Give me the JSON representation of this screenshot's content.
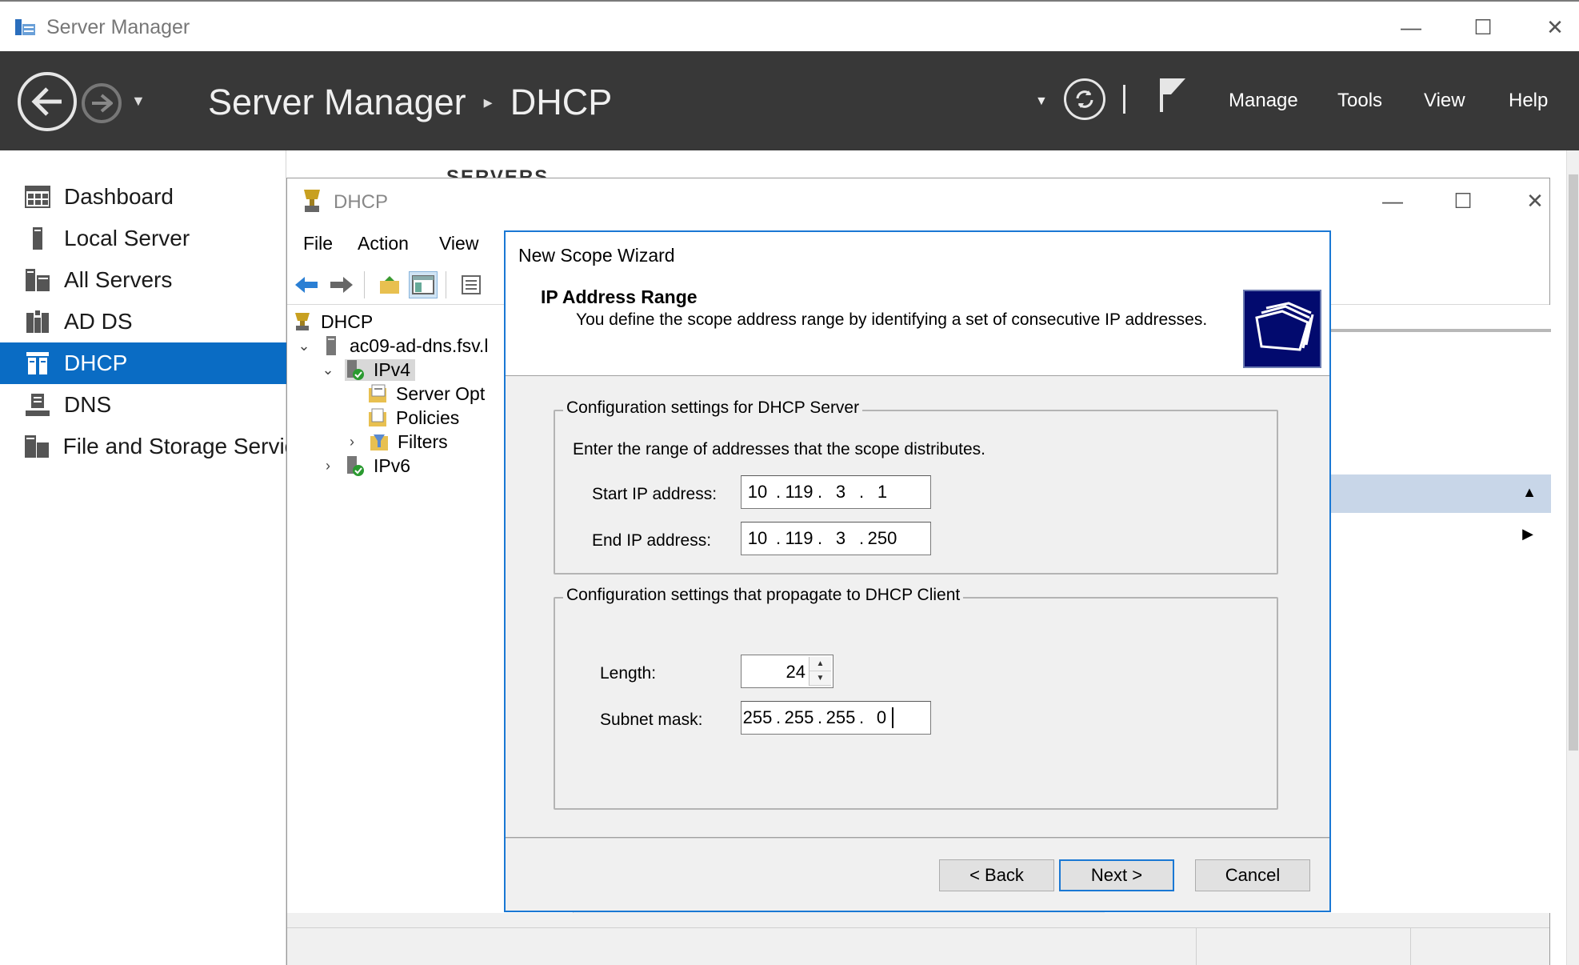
{
  "window": {
    "title": "Server Manager",
    "controls": {
      "minimize": "—",
      "maximize": "☐",
      "close": "✕"
    }
  },
  "header": {
    "breadcrumb_root": "Server Manager",
    "breadcrumb_separator": "▸",
    "breadcrumb_current": "DHCP",
    "menu": {
      "manage": "Manage",
      "tools": "Tools",
      "view": "View",
      "help": "Help"
    }
  },
  "sidebar": {
    "items": [
      {
        "label": "Dashboard",
        "icon": "dashboard-icon"
      },
      {
        "label": "Local Server",
        "icon": "local-server-icon"
      },
      {
        "label": "All Servers",
        "icon": "all-servers-icon"
      },
      {
        "label": "AD DS",
        "icon": "ad-ds-icon"
      },
      {
        "label": "DHCP",
        "icon": "dhcp-icon",
        "active": true
      },
      {
        "label": "DNS",
        "icon": "dns-icon"
      },
      {
        "label": "File and Storage Servic",
        "icon": "file-storage-icon"
      }
    ]
  },
  "background_panel": {
    "servers_label": "SERVERS"
  },
  "mmc": {
    "title": "DHCP",
    "menu": {
      "file": "File",
      "action": "Action",
      "view": "View"
    },
    "tree": {
      "root": "DHCP",
      "server": "ac09-ad-dns.fsv.l",
      "ipv4": "IPv4",
      "server_options": "Server Opt",
      "policies": "Policies",
      "filters": "Filters",
      "ipv6": "IPv6"
    }
  },
  "wizard": {
    "title": "New Scope Wizard",
    "heading": "IP Address Range",
    "subheading": "You define the scope address range by identifying a set of consecutive IP addresses.",
    "group1": {
      "legend": "Configuration settings for DHCP Server",
      "instruction": "Enter the range of addresses that the scope distributes.",
      "start_label": "Start IP address:",
      "start_ip": [
        "10",
        "119",
        "3",
        "1"
      ],
      "end_label": "End IP address:",
      "end_ip": [
        "10",
        "119",
        "3",
        "250"
      ]
    },
    "group2": {
      "legend": "Configuration settings that propagate to DHCP Client",
      "length_label": "Length:",
      "length_value": "24",
      "mask_label": "Subnet mask:",
      "subnet_mask": [
        "255",
        "255",
        "255",
        "0"
      ]
    },
    "buttons": {
      "back": "< Back",
      "next": "Next >",
      "cancel": "Cancel"
    }
  },
  "colors": {
    "header_bg": "#383838",
    "sidebar_active": "#0a6cc4",
    "wizard_border": "#1a78d4",
    "wizard_logo_bg": "#020a6e"
  }
}
